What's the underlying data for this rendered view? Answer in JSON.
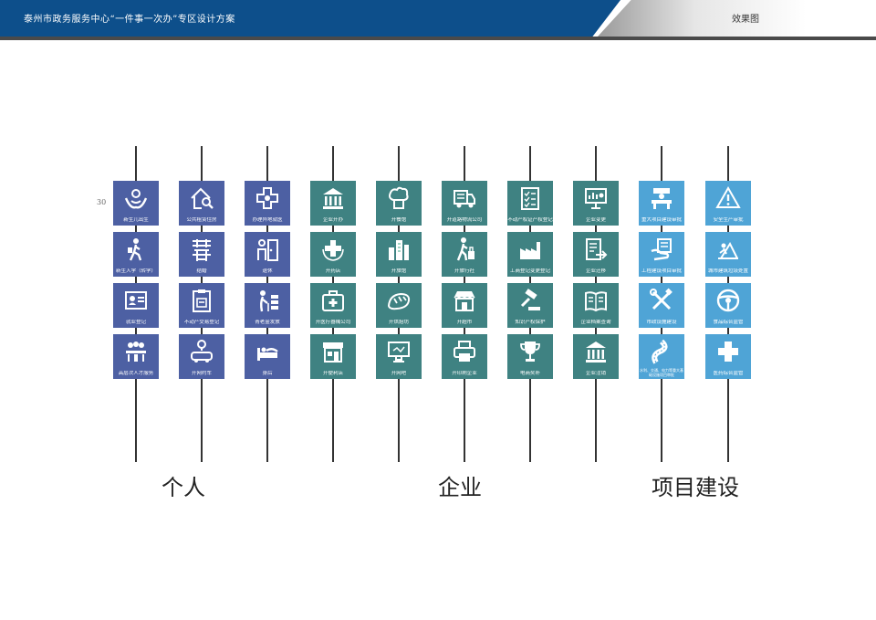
{
  "header": {
    "title": "泰州市政务服务中心“一件事一次办”专区设计方案",
    "right_label": "效果图"
  },
  "page_number": "30",
  "categories": [
    "个人",
    "企业",
    "项目建设"
  ],
  "colors": {
    "personal": "#4d60a3",
    "enterprise": "#3f8282",
    "project": "#4fa4d6",
    "header": "#0d4f8b"
  },
  "columns": [
    {
      "tiles": [
        {
          "label": "新生儿出生",
          "icon": "baby-hands-icon"
        },
        {
          "label": "新生入学（转学）",
          "icon": "student-walking-icon"
        },
        {
          "label": "就业登记",
          "icon": "id-card-icon"
        },
        {
          "label": "高层次人才服务",
          "icon": "meeting-people-icon"
        }
      ]
    },
    {
      "tiles": [
        {
          "label": "公共租赁住房",
          "icon": "house-search-icon"
        },
        {
          "label": "结婚",
          "icon": "double-happiness-icon"
        },
        {
          "label": "不动产交易登记",
          "icon": "clipboard-icon"
        },
        {
          "label": "开网约车",
          "icon": "car-location-icon"
        }
      ]
    },
    {
      "tiles": [
        {
          "label": "办理异地就医",
          "icon": "medical-cross-icon"
        },
        {
          "label": "退休",
          "icon": "person-door-icon"
        },
        {
          "label": "青老金发放",
          "icon": "elderly-cane-icon"
        },
        {
          "label": "身后",
          "icon": "bed-icon"
        }
      ]
    },
    {
      "tiles": [
        {
          "label": "企业开办",
          "icon": "bank-building-icon"
        },
        {
          "label": "开药店",
          "icon": "cross-wreath-icon"
        },
        {
          "label": "开医疗器械公司",
          "icon": "first-aid-kit-icon"
        },
        {
          "label": "开便利店",
          "icon": "storefront-icon"
        }
      ]
    },
    {
      "tiles": [
        {
          "label": "开餐馆",
          "icon": "chef-hat-icon"
        },
        {
          "label": "开旅馆",
          "icon": "city-buildings-icon"
        },
        {
          "label": "开烘焙坊",
          "icon": "bread-icon"
        },
        {
          "label": "开网吧",
          "icon": "monitor-icon"
        }
      ]
    },
    {
      "tiles": [
        {
          "label": "开道路物流公司",
          "icon": "delivery-truck-icon"
        },
        {
          "label": "开旅行社",
          "icon": "traveler-luggage-icon"
        },
        {
          "label": "开超市",
          "icon": "supermarket-icon"
        },
        {
          "label": "开印刷企业",
          "icon": "printer-icon"
        }
      ]
    },
    {
      "tiles": [
        {
          "label": "不动产权证产权登记",
          "icon": "checklist-icon"
        },
        {
          "label": "工商登记变更登记",
          "icon": "factory-icon"
        },
        {
          "label": "知识产权保护",
          "icon": "gavel-icon"
        },
        {
          "label": "电商奖补",
          "icon": "trophy-icon"
        }
      ]
    },
    {
      "tiles": [
        {
          "label": "企业变更",
          "icon": "presentation-board-icon"
        },
        {
          "label": "企业迁移",
          "icon": "document-arrow-icon"
        },
        {
          "label": "企业档案查询",
          "icon": "open-book-icon"
        },
        {
          "label": "企业注销",
          "icon": "bank-building-icon"
        }
      ]
    },
    {
      "tiles": [
        {
          "label": "重大项目建设审批",
          "icon": "desk-person-icon"
        },
        {
          "label": "工程建设项目审批",
          "icon": "hand-document-icon"
        },
        {
          "label": "市政设施建设",
          "icon": "wrench-screwdriver-icon"
        },
        {
          "label": "水利、交通、电力等重大基础设施项目审批",
          "icon": "winding-road-icon"
        }
      ]
    },
    {
      "tiles": [
        {
          "label": "安全生产审批",
          "icon": "warning-triangle-icon"
        },
        {
          "label": "城市建筑垃圾处置",
          "icon": "construction-icon"
        },
        {
          "label": "食品综合监管",
          "icon": "steering-circle-icon"
        },
        {
          "label": "医药综合监管",
          "icon": "plus-cross-icon"
        }
      ]
    }
  ]
}
